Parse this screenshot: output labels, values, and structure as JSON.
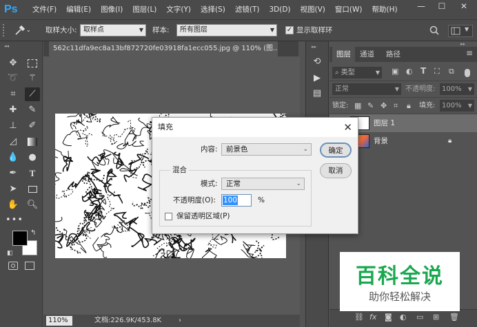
{
  "app": {
    "logo": "Ps"
  },
  "menu": [
    "文件(F)",
    "编辑(E)",
    "图像(I)",
    "图层(L)",
    "文字(Y)",
    "选择(S)",
    "滤镜(T)",
    "3D(D)",
    "视图(V)",
    "窗口(W)",
    "帮助(H)"
  ],
  "window_buttons": {
    "minimize": "—",
    "restore": "☐",
    "close": "✕"
  },
  "options": {
    "tool_icon": "eyedropper-icon",
    "sample_size_label": "取样大小:",
    "sample_size_value": "取样点",
    "sample_label": "样本:",
    "sample_value": "所有图层",
    "show_ring_label": "显示取样环",
    "show_ring_checked": true
  },
  "document": {
    "tab_title": "562c11dfa9ec8a13bf872720fe03918fa1ecc055.jpg @ 110% (图...",
    "tab_close": "×",
    "zoom": "110%",
    "doc_info": "文档:226.9K/453.8K",
    "status_arrow": "›"
  },
  "layers_panel": {
    "tabs": [
      "图层",
      "通道",
      "路径"
    ],
    "filter_label": "类型",
    "blend_mode": "正常",
    "opacity_label": "不透明度:",
    "opacity_value": "100%",
    "lock_label": "锁定:",
    "fill_label": "填充:",
    "fill_value": "100%",
    "layers": [
      {
        "name": "图层 1",
        "selected": true
      },
      {
        "name": "背景",
        "locked": true
      }
    ]
  },
  "dialog": {
    "title": "填充",
    "close": "✕",
    "content_label": "内容:",
    "content_value": "前景色",
    "ok_label": "确定",
    "cancel_label": "取消",
    "group_label": "混合",
    "mode_label": "模式:",
    "mode_value": "正常",
    "opacity_label": "不透明度(O):",
    "opacity_value": "100",
    "opacity_unit": "%",
    "preserve_label": "保留透明区域(P)",
    "preserve_checked": false
  },
  "watermark": {
    "title": "百科全说",
    "subtitle": "助你轻松解决"
  },
  "colors": {
    "foreground": "#000000",
    "background": "#ffffff",
    "accent": "#31a8ff",
    "watermark_green": "#19a84f"
  }
}
